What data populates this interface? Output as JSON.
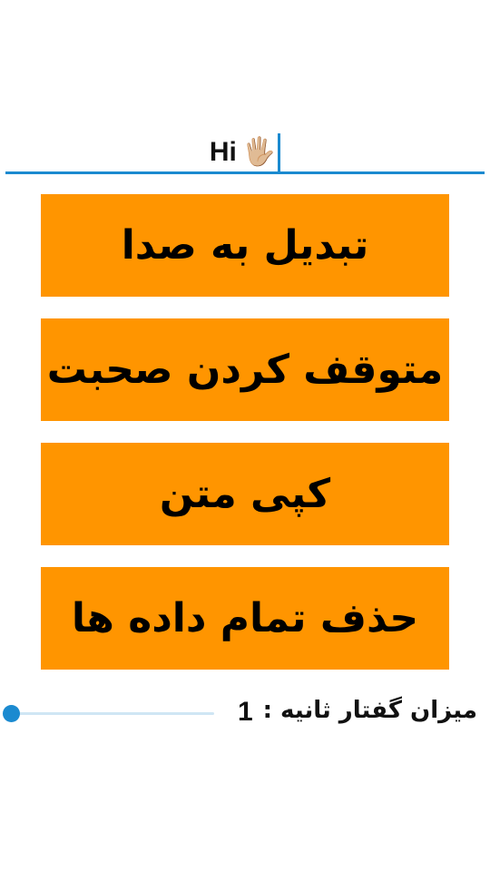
{
  "input": {
    "value": "Hi",
    "emoji": "🖐🏼",
    "emoji_icon": "raised-hand-icon"
  },
  "buttons": [
    {
      "label": "تبدیل به صدا"
    },
    {
      "label": "متوقف کردن صحبت"
    },
    {
      "label": "کپی متن"
    },
    {
      "label": "حذف تمام داده ها"
    }
  ],
  "speech_rate": {
    "label": "میزان گفتار ثانیه :",
    "value": "1",
    "slider_fraction": 0.0
  },
  "colors": {
    "accent": "#1b8ad0",
    "button_background": "#ff9500",
    "button_text": "#000000",
    "background": "#ffffff"
  }
}
